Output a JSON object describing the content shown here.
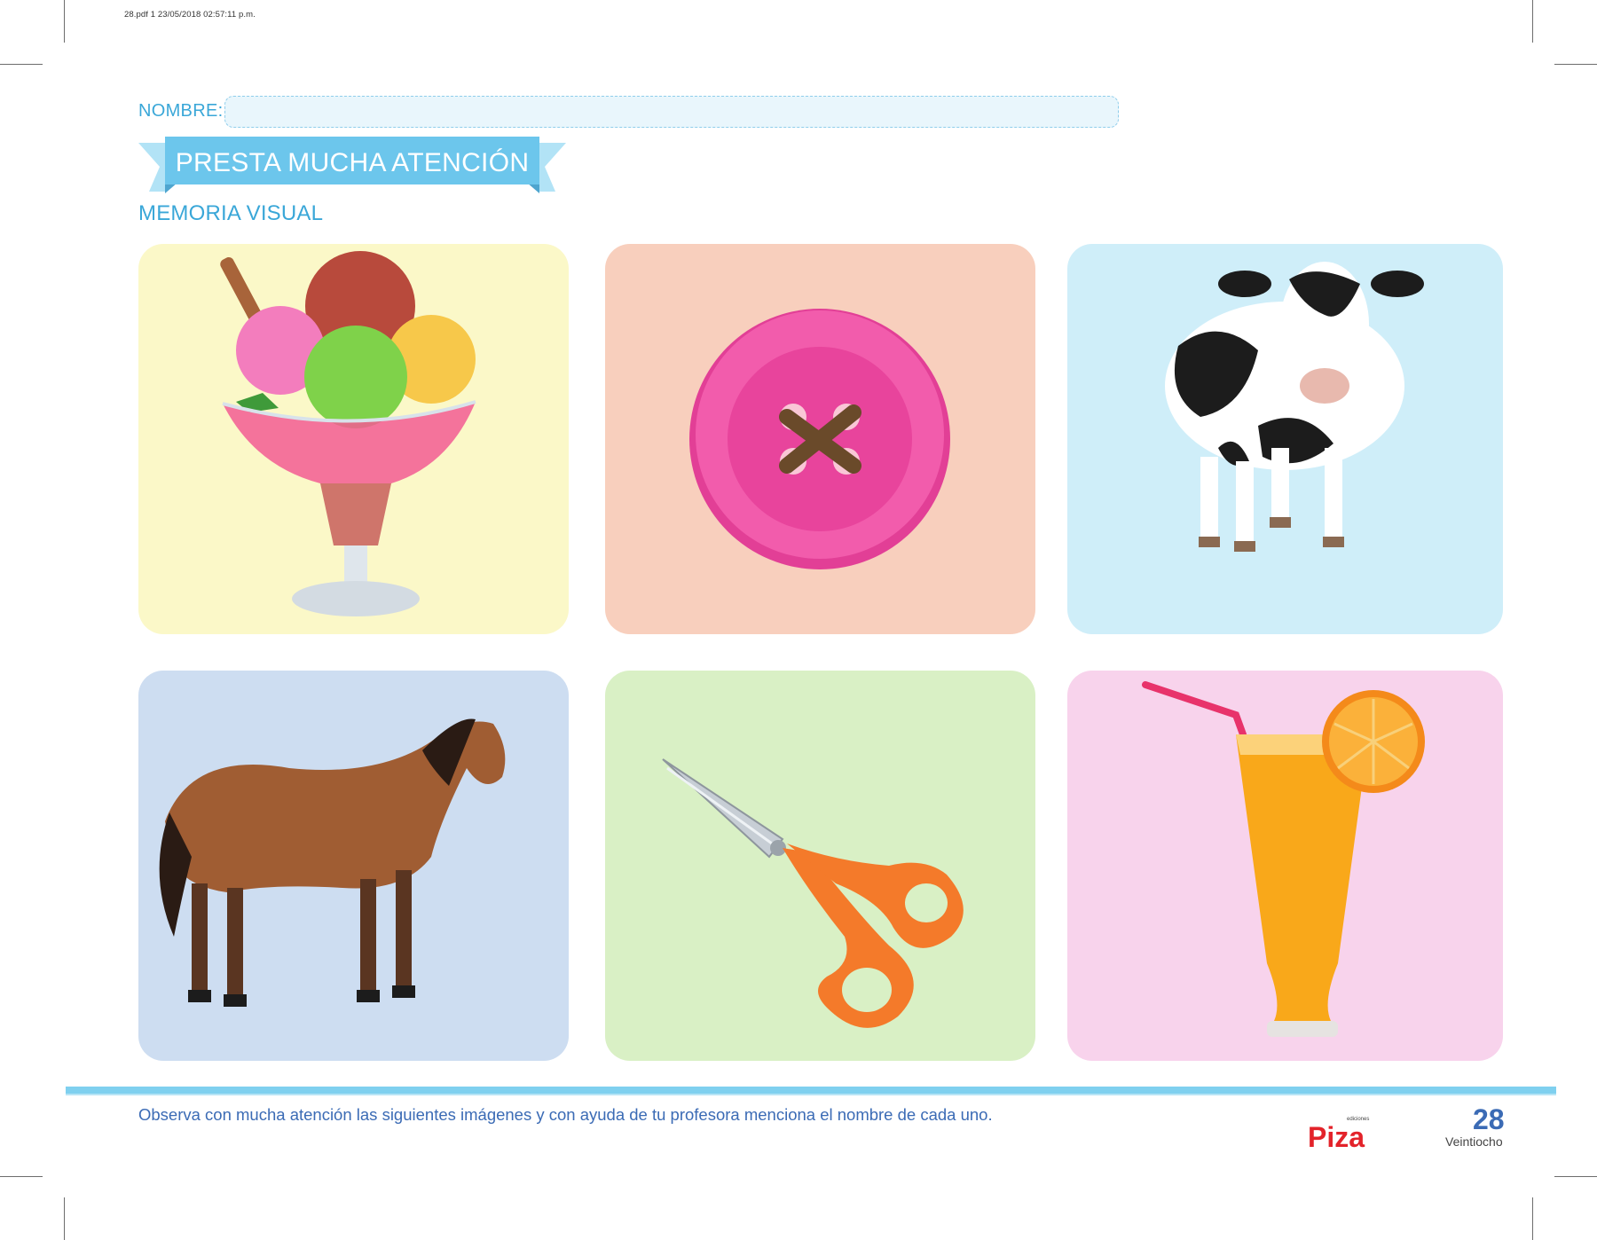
{
  "print_header": "28.pdf   1   23/05/2018   02:57:11 p.m.",
  "name_label": "NOMBRE:",
  "banner_title": "PRESTA MUCHA ATENCIÓN",
  "subtitle": "MEMORIA VISUAL",
  "cards": [
    {
      "picture": "ice-cream-sundae",
      "background": "#fbf8c8"
    },
    {
      "picture": "pink-button",
      "background": "#f8cfbd"
    },
    {
      "picture": "cow",
      "background": "#cfeef9"
    },
    {
      "picture": "horse",
      "background": "#cdddf1"
    },
    {
      "picture": "scissors",
      "background": "#d9f0c5"
    },
    {
      "picture": "orange-juice",
      "background": "#f8d3ec"
    }
  ],
  "instruction": "Observa con mucha atención las siguientes imágenes y con ayuda de tu profesora menciona el nombre de cada uno.",
  "logo": {
    "brand": "Piza",
    "sup": "ediciones"
  },
  "page_number": "28",
  "page_word": "Veintiocho",
  "colors": {
    "accent": "#3aa7d8",
    "banner": "#6cc6ec",
    "footer_text": "#3b6bb5",
    "logo_red": "#e3232a"
  }
}
